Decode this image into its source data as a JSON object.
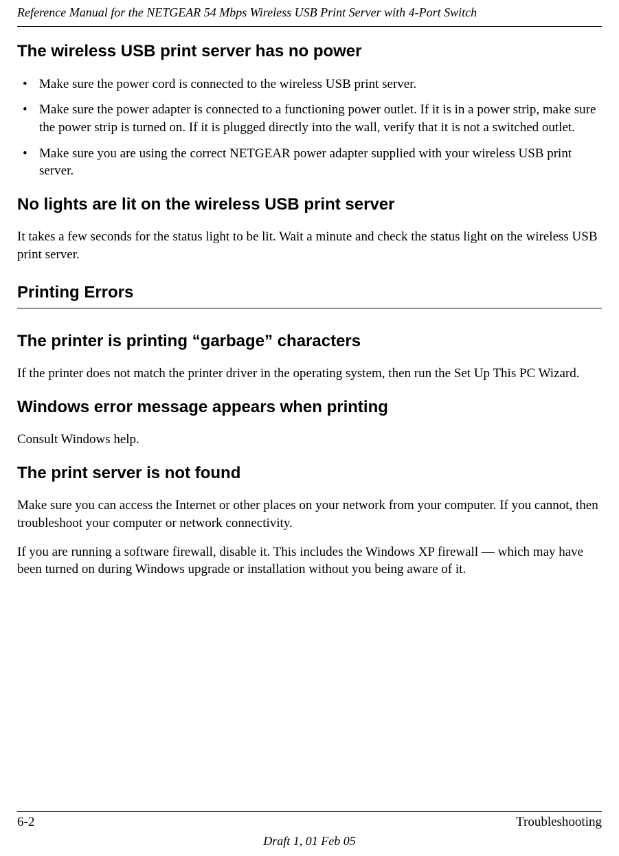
{
  "header": {
    "title": "Reference Manual for the NETGEAR 54 Mbps Wireless USB Print Server with 4-Port Switch"
  },
  "sections": {
    "s1": {
      "heading": "The wireless USB print server has no power",
      "bullets": [
        "Make sure the power cord is connected to the wireless USB print server.",
        "Make sure the power adapter is connected to a functioning power outlet. If it is in a power strip, make sure the power strip is turned on. If it is plugged directly into the wall, verify that it is not a switched outlet.",
        "Make sure you are using the correct NETGEAR power adapter supplied with your wireless USB print server."
      ]
    },
    "s2": {
      "heading": "No lights are lit on the wireless USB print server",
      "body": "It takes a few seconds for the status light to be lit. Wait a minute and check the status light on the wireless USB print server."
    },
    "s3": {
      "heading": "Printing Errors"
    },
    "s4": {
      "heading": "The printer is printing “garbage” characters",
      "body": "If the printer does not match the printer driver in the operating system, then run the Set Up This PC Wizard."
    },
    "s5": {
      "heading": "Windows error message appears when printing",
      "body": "Consult Windows help."
    },
    "s6": {
      "heading": "The print server is not found",
      "body1": "Make sure you can access the Internet or other places on your network from your computer. If you cannot, then troubleshoot your computer or network connectivity.",
      "body2": "If you are running a software firewall, disable it. This includes the Windows XP firewall — which may have been turned on during Windows upgrade or installation without you being aware of it."
    }
  },
  "footer": {
    "page_num": "6-2",
    "section": "Troubleshooting",
    "draft": "Draft 1, 01 Feb 05"
  }
}
